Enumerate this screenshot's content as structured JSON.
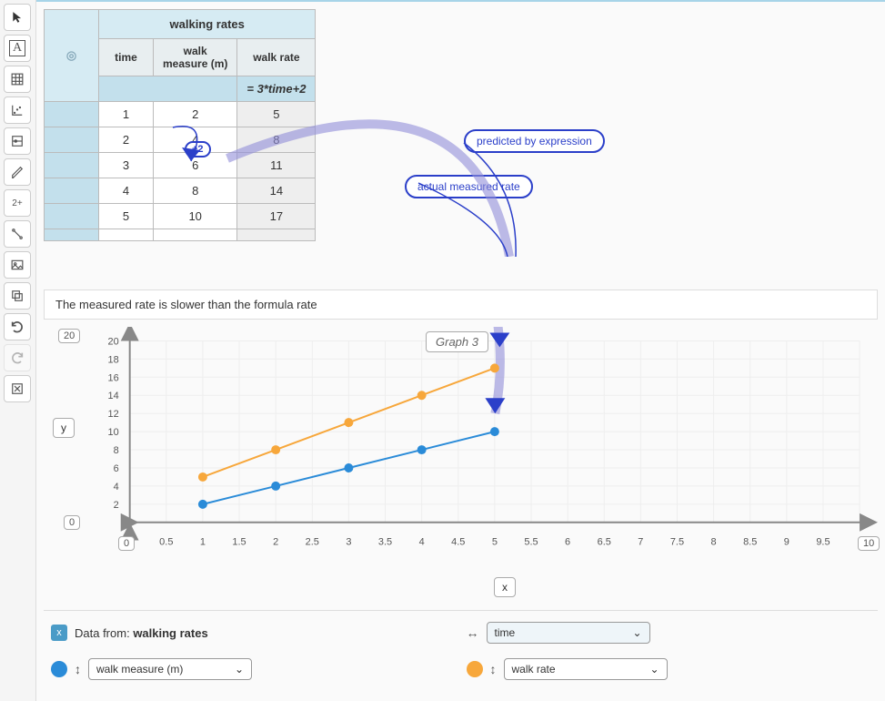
{
  "table": {
    "title": "walking rates",
    "headers": {
      "time": "time",
      "measure": "walk\nmeasure (m)",
      "rate": "walk rate"
    },
    "formula": "= 3*time+2",
    "rows": [
      {
        "time": 1,
        "measure": 2,
        "rate": 5
      },
      {
        "time": 2,
        "measure": 4,
        "rate": 8
      },
      {
        "time": 3,
        "measure": 6,
        "rate": 11
      },
      {
        "time": 4,
        "measure": 8,
        "rate": 14
      },
      {
        "time": 5,
        "measure": 10,
        "rate": 17
      }
    ],
    "delta_badge": "+2"
  },
  "annotations": {
    "predicted": "predicted by expression",
    "actual": "actual measured rate"
  },
  "note": "The measured rate is slower than the formula rate",
  "chart": {
    "title": "Graph 3",
    "x_axis_btn": "x",
    "y_axis_btn": "y",
    "y_max": "20",
    "y_min": "0",
    "x_min": "0",
    "x_max": "10"
  },
  "chart_data": {
    "type": "line",
    "title": "Graph 3",
    "xlabel": "x",
    "ylabel": "y",
    "xlim": [
      0,
      10
    ],
    "ylim": [
      0,
      20
    ],
    "x_ticks": [
      0.5,
      1,
      1.5,
      2,
      2.5,
      3,
      3.5,
      4,
      4.5,
      5,
      5.5,
      6,
      6.5,
      7,
      7.5,
      8,
      8.5,
      9,
      9.5
    ],
    "y_ticks": [
      2,
      4,
      6,
      8,
      10,
      12,
      14,
      16,
      18,
      20
    ],
    "series": [
      {
        "name": "walk measure (m)",
        "color": "#2a8bd8",
        "x": [
          1,
          2,
          3,
          4,
          5
        ],
        "y": [
          2,
          4,
          6,
          8,
          10
        ]
      },
      {
        "name": "walk rate",
        "color": "#f7a73b",
        "x": [
          1,
          2,
          3,
          4,
          5
        ],
        "y": [
          5,
          8,
          11,
          14,
          17
        ]
      }
    ]
  },
  "controls": {
    "data_from_label": "Data from:",
    "data_from_value": "walking rates",
    "x_select": "time",
    "series1": {
      "label": "walk measure (m)",
      "color": "#2a8bd8"
    },
    "series2": {
      "label": "walk rate",
      "color": "#f7a73b"
    }
  }
}
